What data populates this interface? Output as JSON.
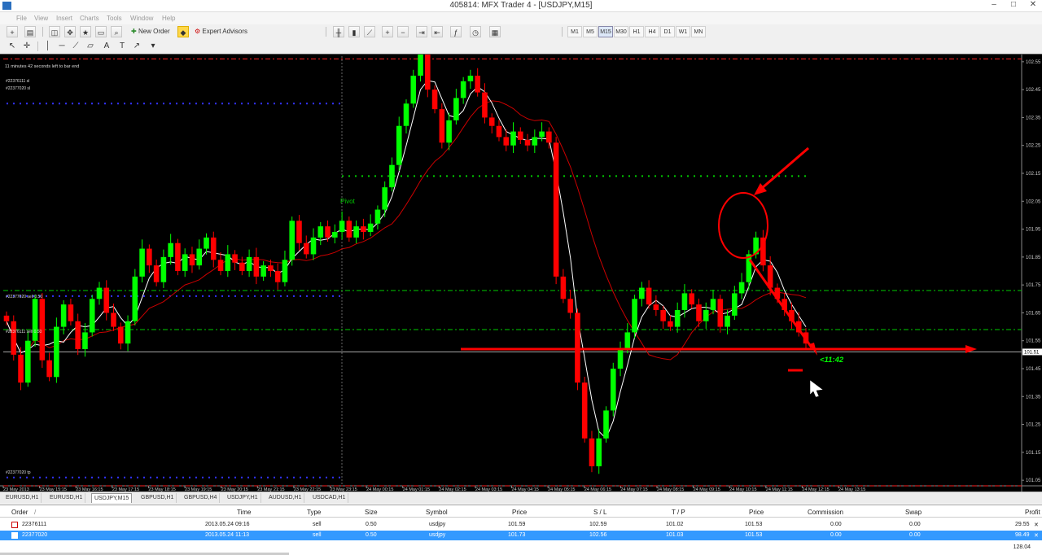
{
  "window": {
    "title": "405814: MFX Trader 4 - [USDJPY,M15]"
  },
  "menu": [
    "File",
    "View",
    "Insert",
    "Charts",
    "Tools",
    "Window",
    "Help"
  ],
  "toolbar": {
    "new_order": "New Order",
    "expert_advisors": "Expert Advisors",
    "timeframes": [
      "M1",
      "M5",
      "M15",
      "M30",
      "H1",
      "H4",
      "D1",
      "W1",
      "MN"
    ]
  },
  "chart": {
    "symbol": "USDJPY",
    "timeframe": "M15",
    "bar_timer": "11 minutes 42 seconds left to bar end",
    "countdown": "<11:42",
    "pivot_label": "Pivot",
    "current_price": "101.51",
    "order_labels": {
      "sl_1": "#22376111 sl",
      "sl_2": "#22377020 sl",
      "sell_1": "#22377020 sell 0.50",
      "sell_2": "#22376111 sell 0.50",
      "tp": "#22377020 tp"
    },
    "time_labels": [
      "23 May 2013",
      "23 May 15:15",
      "23 May 16:15",
      "23 May 17:15",
      "23 May 18:15",
      "23 May 19:15",
      "23 May 20:15",
      "23 May 21:15",
      "23 May 22:15",
      "23 May 23:15",
      "24 May 00:15",
      "24 May 01:15",
      "24 May 02:15",
      "24 May 03:15",
      "24 May 04:15",
      "24 May 05:15",
      "24 May 06:15",
      "24 May 07:15",
      "24 May 08:15",
      "24 May 09:15",
      "24 May 10:15",
      "24 May 11:15",
      "24 May 12:15",
      "24 May 13:15"
    ]
  },
  "chart_data": {
    "type": "candlestick",
    "symbol": "USDJPY",
    "timeframe": "M15",
    "ylim": [
      101.03,
      102.57
    ],
    "y_ticks": [
      102.55,
      102.45,
      102.35,
      102.25,
      102.15,
      102.05,
      101.95,
      101.85,
      101.75,
      101.65,
      101.55,
      101.45,
      101.35,
      101.25,
      101.15,
      101.05
    ],
    "current_price": 101.51,
    "levels": {
      "stop_loss_1": 102.59,
      "stop_loss_2": 102.56,
      "entry_sell_1": 101.73,
      "entry_sell_2": 101.59,
      "take_profit": 101.03,
      "pivot": 102.14,
      "resistance": 101.95,
      "support": 101.52
    }
  },
  "tabs": [
    "EURUSD,H1",
    "EURUSD,H1",
    "USDJPY,M15",
    "GBPUSD,H1",
    "GBPUSD,H4",
    "USDJPY,H1",
    "AUDUSD,H1",
    "USDCAD,H1"
  ],
  "active_tab_index": 2,
  "terminal": {
    "columns": [
      "Order",
      "/",
      "Time",
      "Type",
      "Size",
      "Symbol",
      "Price",
      "S / L",
      "T / P",
      "Price",
      "Commission",
      "Swap",
      "Profit"
    ],
    "rows": [
      {
        "order": "22376111",
        "time": "2013.05.24 09:16",
        "type": "sell",
        "size": "0.50",
        "symbol": "usdjpy",
        "price": "101.59",
        "sl": "102.59",
        "tp": "101.02",
        "cur_price": "101.53",
        "commission": "0.00",
        "swap": "0.00",
        "profit": "29.55"
      },
      {
        "order": "22377020",
        "time": "2013.05.24 11:13",
        "type": "sell",
        "size": "0.50",
        "symbol": "usdjpy",
        "price": "101.73",
        "sl": "102.56",
        "tp": "101.03",
        "cur_price": "101.53",
        "commission": "0.00",
        "swap": "0.00",
        "profit": "98.49"
      }
    ],
    "total_profit": "128.04"
  },
  "colors": {
    "bull": "#00ff00",
    "bear": "#ff0000",
    "background": "#000000",
    "ma_fast": "#ffffff",
    "ma_slow": "#cc0000",
    "selected_row": "#3399ff"
  }
}
